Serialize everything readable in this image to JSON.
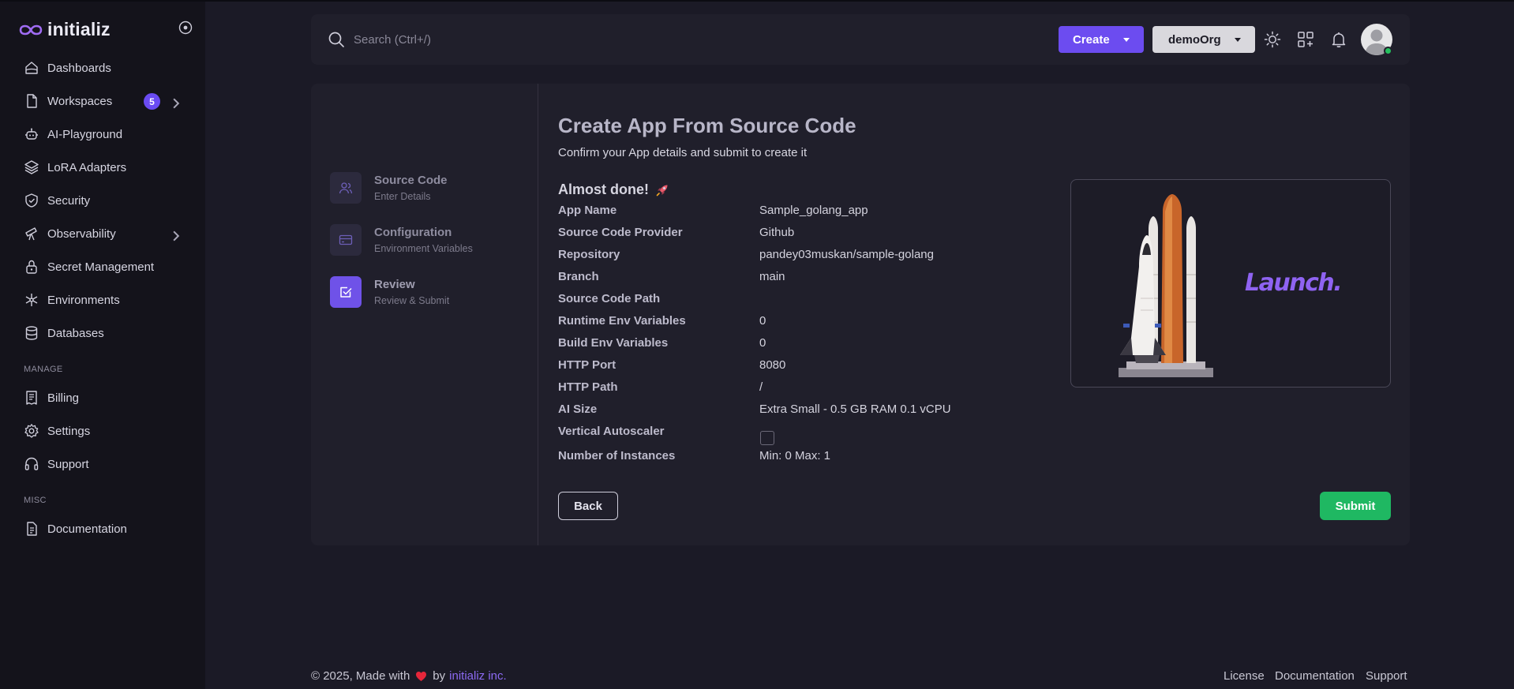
{
  "app": {
    "name": "initializ"
  },
  "sidebar": {
    "items": [
      {
        "label": "Dashboards",
        "icon": "home-icon"
      },
      {
        "label": "Workspaces",
        "icon": "file-icon",
        "badge": "5"
      },
      {
        "label": "AI-Playground",
        "icon": "robot-icon"
      },
      {
        "label": "LoRA Adapters",
        "icon": "layers-icon"
      },
      {
        "label": "Security",
        "icon": "shield-check-icon"
      },
      {
        "label": "Observability",
        "icon": "telescope-icon"
      },
      {
        "label": "Secret Management",
        "icon": "lock-icon"
      },
      {
        "label": "Environments",
        "icon": "snowflake-icon"
      },
      {
        "label": "Databases",
        "icon": "database-icon"
      }
    ],
    "manage_label": "MANAGE",
    "manage_items": [
      {
        "label": "Billing",
        "icon": "receipt-icon"
      },
      {
        "label": "Settings",
        "icon": "gear-icon"
      },
      {
        "label": "Support",
        "icon": "headset-icon"
      }
    ],
    "misc_label": "MISC",
    "misc_items": [
      {
        "label": "Documentation",
        "icon": "document-icon"
      }
    ]
  },
  "header": {
    "search_placeholder": "Search (Ctrl+/)",
    "create_label": "Create",
    "org_label": "demoOrg"
  },
  "steps": [
    {
      "title": "Source Code",
      "subtitle": "Enter Details",
      "state": "done"
    },
    {
      "title": "Configuration",
      "subtitle": "Environment Variables",
      "state": "done"
    },
    {
      "title": "Review",
      "subtitle": "Review & Submit",
      "state": "active"
    }
  ],
  "main": {
    "title": "Create App From Source Code",
    "subtitle": "Confirm your App details and submit to create it",
    "almost_done": "Almost done!",
    "details": [
      {
        "label": "App Name",
        "value": "Sample_golang_app"
      },
      {
        "label": "Source Code Provider",
        "value": "Github"
      },
      {
        "label": "Repository",
        "value": "pandey03muskan/sample-golang"
      },
      {
        "label": "Branch",
        "value": "main"
      },
      {
        "label": "Source Code Path",
        "value": ""
      },
      {
        "label": "Runtime Env Variables",
        "value": "0"
      },
      {
        "label": "Build Env Variables",
        "value": "0"
      },
      {
        "label": "HTTP Port",
        "value": "8080"
      },
      {
        "label": "HTTP Path",
        "value": "/"
      },
      {
        "label": "AI Size",
        "value": "Extra Small - 0.5 GB RAM 0.1 vCPU"
      },
      {
        "label": "Vertical Autoscaler",
        "value": ""
      },
      {
        "label": "Number of Instances",
        "value": "Min: 0 Max: 1"
      }
    ],
    "autoscaler_checked": false,
    "launch_text": "Launch.",
    "back_label": "Back",
    "submit_label": "Submit"
  },
  "footer": {
    "copyright_prefix": "© 2025, Made with",
    "by": "by",
    "company": "initializ inc.",
    "links": [
      "License",
      "Documentation",
      "Support"
    ]
  },
  "colors": {
    "accent": "#6c4cf0",
    "success": "#1fb862",
    "background": "#1b1a26",
    "sidebar": "#14131b",
    "card": "#201f2b"
  }
}
